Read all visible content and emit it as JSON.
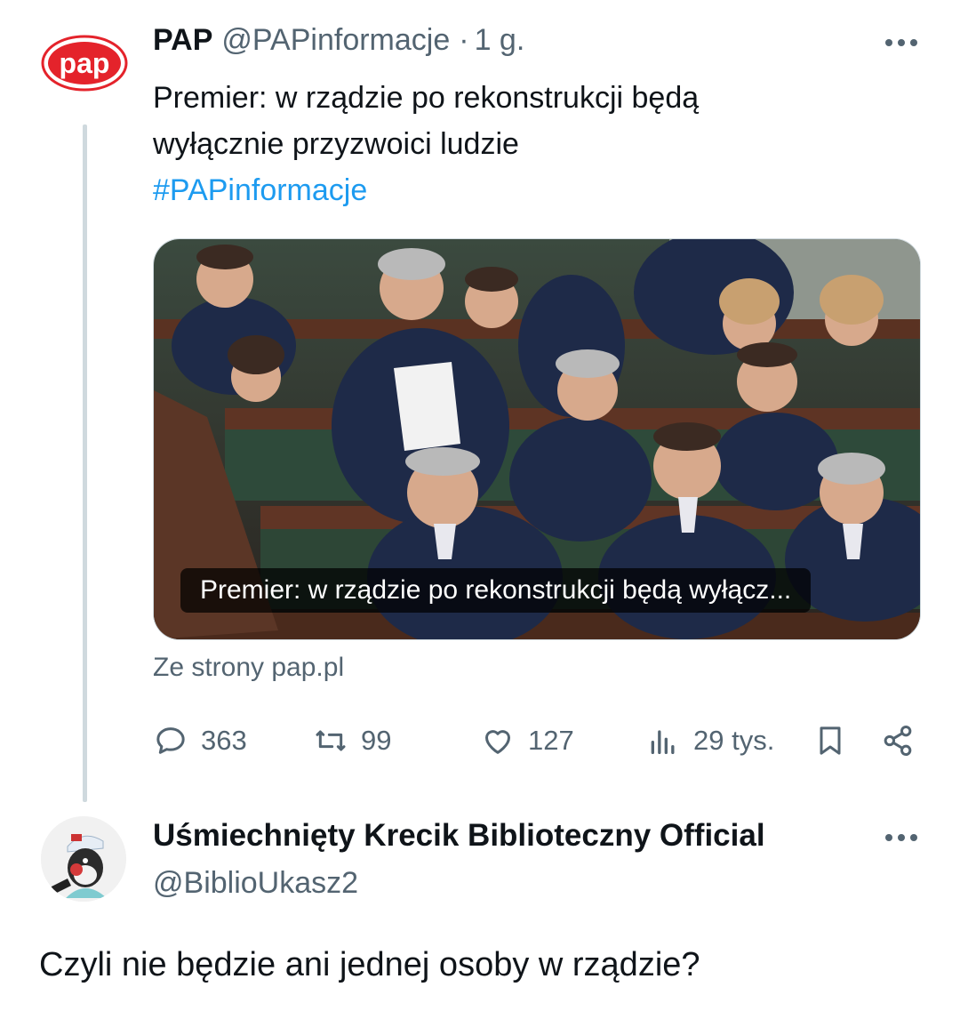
{
  "tweet": {
    "author_name": "PAP",
    "handle": "@PAPinformacje",
    "separator": "·",
    "time": "1 g.",
    "logo_text": "pap",
    "text_line1": "Premier: w rządzie po rekonstrukcji będą",
    "text_line2": "wyłącznie przyzwoici ludzie",
    "hashtag": "#PAPinformacje",
    "media_caption": "Premier: w rządzie po rekonstrukcji będą wyłącz...",
    "source": "Ze strony pap.pl",
    "actions": {
      "replies": "363",
      "retweets": "99",
      "likes": "127",
      "views": "29 tys."
    }
  },
  "reply": {
    "author_name": "Uśmiechnięty Krecik Biblioteczny Official",
    "handle": "@BiblioUkasz2",
    "text": "Czyli nie będzie ani jednej osoby w rządzie?"
  },
  "colors": {
    "brand_red": "#e4232b",
    "link_blue": "#1d9bf0",
    "secondary_text": "#536471",
    "thread_line": "#cfd9de"
  },
  "icons": [
    "more-horizontal-icon",
    "reply-icon",
    "retweet-icon",
    "like-icon",
    "views-icon",
    "bookmark-icon",
    "share-icon"
  ]
}
